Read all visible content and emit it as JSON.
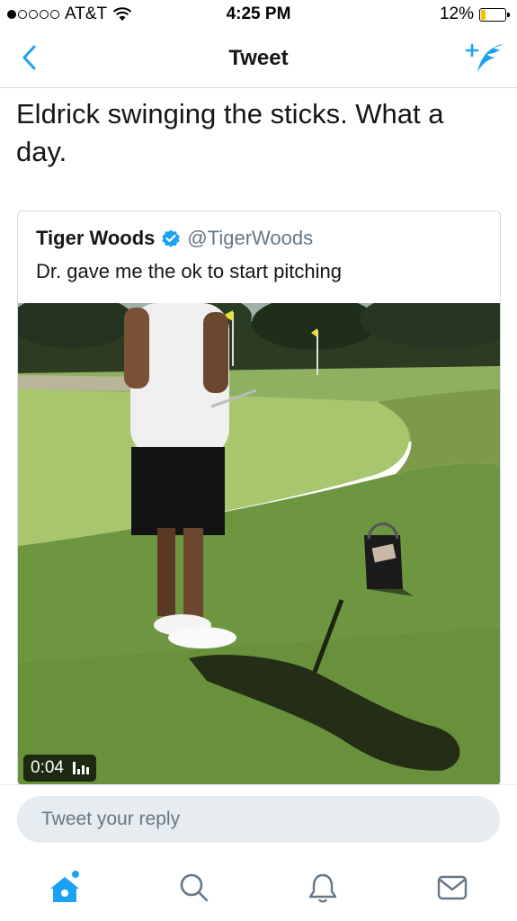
{
  "status_bar": {
    "carrier": "AT&T",
    "time": "4:25 PM",
    "battery": "12%"
  },
  "nav": {
    "title": "Tweet",
    "back_icon": "chevron-left-icon",
    "compose_icon": "compose-tweet-icon"
  },
  "tweet": {
    "text": "Eldrick swinging the sticks. What a day."
  },
  "quoted_tweet": {
    "name": "Tiger Woods",
    "handle": "@TigerWoods",
    "verified": true,
    "text": "Dr. gave me the ok to start pitching",
    "video": {
      "duration": "0:04"
    }
  },
  "reply": {
    "placeholder": "Tweet your reply"
  },
  "tab_bar": {
    "items": [
      {
        "icon": "home-icon",
        "active": true
      },
      {
        "icon": "search-icon",
        "active": false
      },
      {
        "icon": "notifications-icon",
        "active": false
      },
      {
        "icon": "messages-icon",
        "active": false
      }
    ]
  },
  "colors": {
    "accent": "#1da1f2",
    "text": "#14171a",
    "muted": "#657786",
    "reply_bg": "#e6ecf0",
    "battery_low": "#f5c400"
  }
}
